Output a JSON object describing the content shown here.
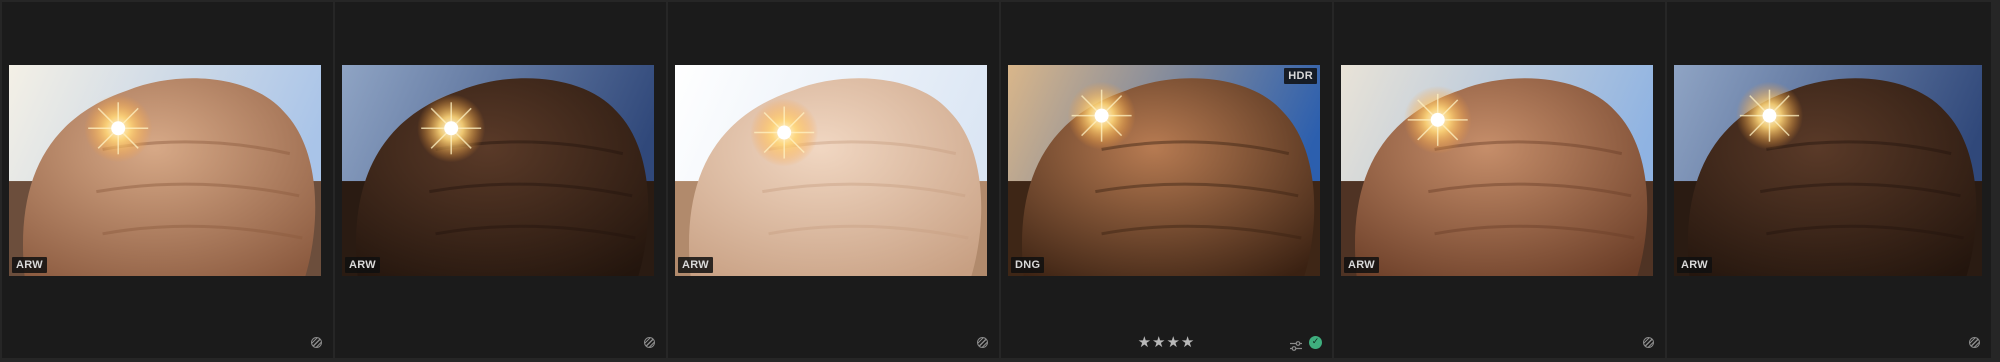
{
  "filmstrip": {
    "photos": [
      {
        "file_type": "ARW",
        "hdr": "",
        "rating_stars": "",
        "edited": false,
        "flagged": false,
        "tone": "bright",
        "sun_x": 0.35,
        "sun_y": 0.3
      },
      {
        "file_type": "ARW",
        "hdr": "",
        "rating_stars": "",
        "edited": false,
        "flagged": false,
        "tone": "dark",
        "sun_x": 0.35,
        "sun_y": 0.3
      },
      {
        "file_type": "ARW",
        "hdr": "",
        "rating_stars": "",
        "edited": false,
        "flagged": false,
        "tone": "overexposed",
        "sun_x": 0.35,
        "sun_y": 0.32
      },
      {
        "file_type": "DNG",
        "hdr": "HDR",
        "rating_stars": "★★★★",
        "edited": true,
        "flagged": true,
        "tone": "hdr",
        "sun_x": 0.3,
        "sun_y": 0.24
      },
      {
        "file_type": "ARW",
        "hdr": "",
        "rating_stars": "",
        "edited": false,
        "flagged": false,
        "tone": "mid",
        "sun_x": 0.31,
        "sun_y": 0.26
      },
      {
        "file_type": "ARW",
        "hdr": "",
        "rating_stars": "",
        "edited": false,
        "flagged": false,
        "tone": "dark",
        "sun_x": 0.31,
        "sun_y": 0.24
      }
    ]
  },
  "colors": {
    "background": "#262626",
    "cell": "#1b1b1b",
    "flag_green": "#3fae7e"
  },
  "icons": {
    "stack": "stack-icon",
    "edit": "sliders-icon",
    "flag": "check-circle-icon"
  }
}
